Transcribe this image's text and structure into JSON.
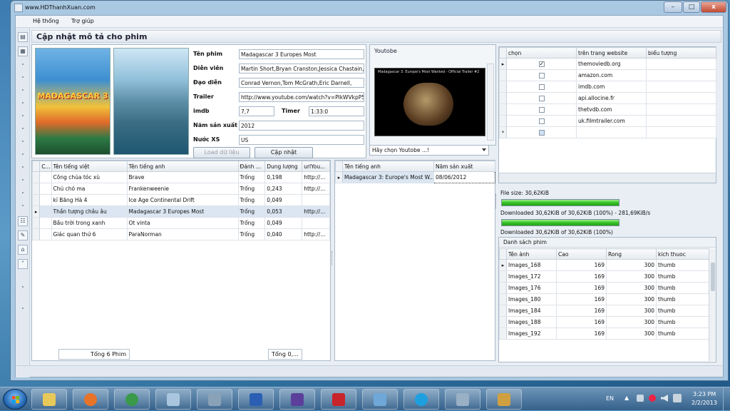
{
  "window": {
    "title": "www.HDThanhXuan.com",
    "minimize": "–",
    "maximize": "□",
    "close": "x"
  },
  "menu": {
    "items": [
      "Hệ thống",
      "Trợ giúp"
    ]
  },
  "form": {
    "title": "Cập nhật mô tả cho phim",
    "poster_text": "MADAGASCAR 3",
    "labels": {
      "ten_phim": "Tên phim",
      "dien_vien": "Diễn viên",
      "dao_dien": "Đạo diễn",
      "trailer": "Trailer",
      "imdb": "imdb",
      "timer": "Timer",
      "nam_san_xuat": "Năm sản xuất",
      "nuoc_xs": "Nước XS"
    },
    "values": {
      "ten_phim": "Madagascar 3 Europes Most",
      "dien_vien": "Martin Short,Bryan Cranston,Jessica Chastain,",
      "dao_dien": "Conrad Vernon,Tom McGrath,Eric Darnell,",
      "trailer": "http://www.youtube.com/watch?v=PlkWVkpP5",
      "imdb": "7,7",
      "timer": "1:33:0",
      "nam_san_xuat": "2012",
      "nuoc_xs": "US"
    },
    "btn_load": "Load dữ liệu",
    "btn_update": "Cập nhật"
  },
  "youtube": {
    "title": "Youtobe",
    "video_caption": "Madagascar 3: Europe's Most Wanted - Official Trailer #2",
    "combo_value": "Hãy chọn Youtobe ...!"
  },
  "movies": {
    "columns": [
      "C...",
      "Tên tiếng việt",
      "Tên tiếng anh",
      "Đánh ...",
      "Dung lượng",
      "urlYou..."
    ],
    "rows": [
      [
        "Công chúa tóc xù",
        "Brave",
        "Trống",
        "0,198",
        "http://..."
      ],
      [
        "Chú chó ma",
        "Frankenweenie",
        "Trống",
        "0,243",
        "http://..."
      ],
      [
        "kỉ Băng Hà 4",
        "Ice Age Continental Drift",
        "Trống",
        "0,049",
        ""
      ],
      [
        "Thần tượng châu âu",
        "Madagascar 3 Europes Most",
        "Trống",
        "0,053",
        "http://..."
      ],
      [
        "Bầu trời trong xanh",
        "Ot vinta",
        "Trống",
        "0,049",
        ""
      ],
      [
        "Giác quan thứ 6",
        "ParaNorman",
        "Trống",
        "0,040",
        "http://..."
      ]
    ],
    "total_label": "Tổng  6 Phim",
    "total_size": "Tổng  0,..."
  },
  "search": {
    "columns": [
      "Tên tiếng anh",
      "Năm sản xuất"
    ],
    "rows": [
      [
        "Madagascar 3: Europe's Most W...",
        "08/06/2012"
      ]
    ]
  },
  "sites": {
    "columns": [
      "chọn",
      "trên trang website",
      "biểu tượng"
    ],
    "rows": [
      "themoviedb.org",
      "amazon.com",
      "imdb.com",
      "api.allocine.fr",
      "thetvdb.com",
      "uk.filmtrailer.com"
    ],
    "checked_mark": "✓",
    "new_row_marker": "*"
  },
  "download": {
    "file_size": "File size: 30,62KiB",
    "status1": "Downloaded 30,62KiB of 30,62KiB (100%) - 281,69KiB/s",
    "status2": "Downloaded 30,62KiB of 30,62KiB (100%)",
    "progress1": 1.0,
    "progress2": 1.0
  },
  "images": {
    "title": "Danh sách phim",
    "columns": [
      "Tên ảnh",
      "Cao",
      "Rong",
      "kich thuoc"
    ],
    "rows": [
      [
        "Images_168",
        "169",
        "300",
        "thumb"
      ],
      [
        "Images_172",
        "169",
        "300",
        "thumb"
      ],
      [
        "Images_176",
        "169",
        "300",
        "thumb"
      ],
      [
        "Images_180",
        "169",
        "300",
        "thumb"
      ],
      [
        "Images_184",
        "169",
        "300",
        "thumb"
      ],
      [
        "Images_188",
        "169",
        "300",
        "thumb"
      ],
      [
        "Images_192",
        "169",
        "300",
        "thumb"
      ]
    ]
  },
  "taskbar": {
    "lang": "EN",
    "time": "3:23 PM",
    "date": "2/2/2013",
    "apps": [
      "explorer",
      "firefox",
      "chrome",
      "notepad",
      "tools",
      "word",
      "vs",
      "kaspersky",
      "pictures",
      "skype",
      "media",
      "paint"
    ]
  }
}
